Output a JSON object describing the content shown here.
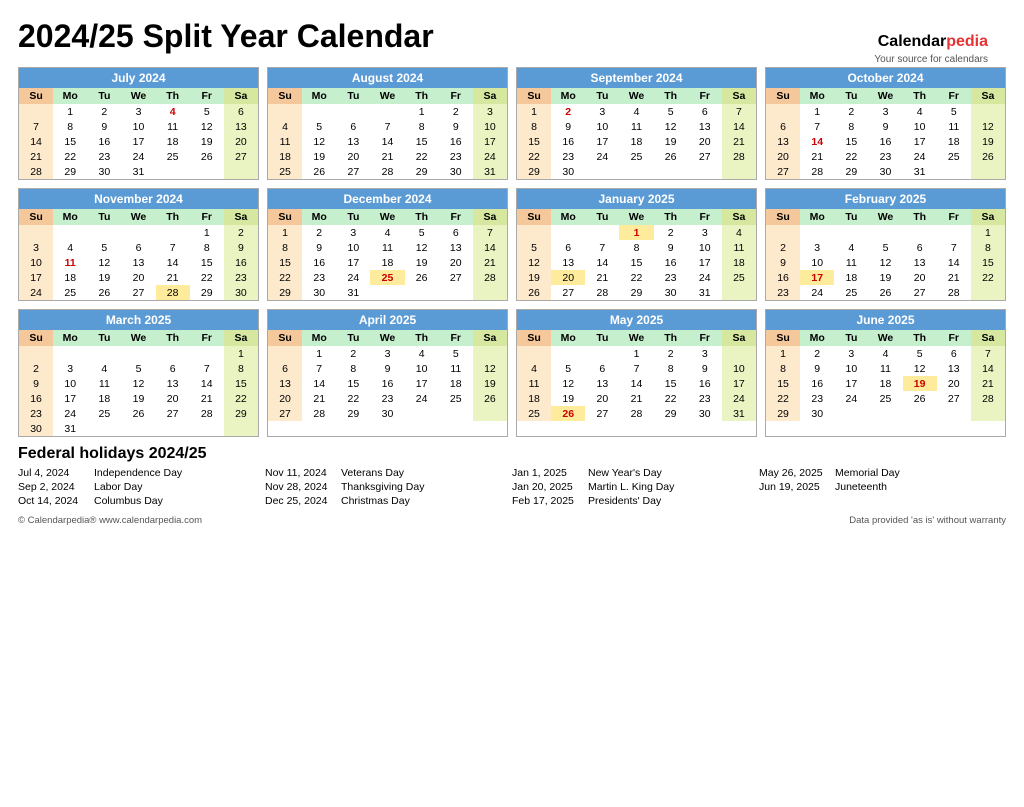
{
  "title": "2024/25 Split Year Calendar",
  "logo": {
    "brand": "Calendar",
    "brand_colored": "pedia",
    "sub": "Your source for calendars"
  },
  "months": [
    {
      "name": "July 2024",
      "start_day": 1,
      "days": 31,
      "weeks": [
        [
          "",
          "1",
          "2",
          "3",
          "4",
          "5",
          "6"
        ],
        [
          "7",
          "8",
          "9",
          "10",
          "11",
          "12",
          "13"
        ],
        [
          "14",
          "15",
          "16",
          "17",
          "18",
          "19",
          "20"
        ],
        [
          "21",
          "22",
          "23",
          "24",
          "25",
          "26",
          "27"
        ],
        [
          "28",
          "29",
          "30",
          "31",
          "",
          "",
          ""
        ]
      ],
      "red_days": [
        "4"
      ],
      "holiday_days": []
    },
    {
      "name": "August 2024",
      "weeks": [
        [
          "",
          "",
          "",
          "",
          "1",
          "2",
          "3"
        ],
        [
          "4",
          "5",
          "6",
          "7",
          "8",
          "9",
          "10"
        ],
        [
          "11",
          "12",
          "13",
          "14",
          "15",
          "16",
          "17"
        ],
        [
          "18",
          "19",
          "20",
          "21",
          "22",
          "23",
          "24"
        ],
        [
          "25",
          "26",
          "27",
          "28",
          "29",
          "30",
          "31"
        ]
      ],
      "red_days": [],
      "holiday_days": []
    },
    {
      "name": "September 2024",
      "weeks": [
        [
          "1",
          "2",
          "3",
          "4",
          "5",
          "6",
          "7"
        ],
        [
          "8",
          "9",
          "10",
          "11",
          "12",
          "13",
          "14"
        ],
        [
          "15",
          "16",
          "17",
          "18",
          "19",
          "20",
          "21"
        ],
        [
          "22",
          "23",
          "24",
          "25",
          "26",
          "27",
          "28"
        ],
        [
          "29",
          "30",
          "",
          "",
          "",
          "",
          ""
        ]
      ],
      "red_days": [
        "2"
      ],
      "holiday_days": []
    },
    {
      "name": "October 2024",
      "weeks": [
        [
          "",
          "1",
          "2",
          "3",
          "4",
          "5",
          ""
        ],
        [
          "6",
          "7",
          "8",
          "9",
          "10",
          "11",
          "12"
        ],
        [
          "13",
          "14",
          "15",
          "16",
          "17",
          "18",
          "19"
        ],
        [
          "20",
          "21",
          "22",
          "23",
          "24",
          "25",
          "26"
        ],
        [
          "27",
          "28",
          "29",
          "30",
          "31",
          "",
          ""
        ]
      ],
      "red_days": [
        "14"
      ],
      "holiday_days": []
    },
    {
      "name": "November 2024",
      "weeks": [
        [
          "",
          "",
          "",
          "",
          "",
          "1",
          "2"
        ],
        [
          "3",
          "4",
          "5",
          "6",
          "7",
          "8",
          "9"
        ],
        [
          "10",
          "11",
          "12",
          "13",
          "14",
          "15",
          "16"
        ],
        [
          "17",
          "18",
          "19",
          "20",
          "21",
          "22",
          "23"
        ],
        [
          "24",
          "25",
          "26",
          "27",
          "28",
          "29",
          "30"
        ]
      ],
      "red_days": [
        "11"
      ],
      "holiday_days": [
        "28"
      ]
    },
    {
      "name": "December 2024",
      "weeks": [
        [
          "1",
          "2",
          "3",
          "4",
          "5",
          "6",
          "7"
        ],
        [
          "8",
          "9",
          "10",
          "11",
          "12",
          "13",
          "14"
        ],
        [
          "15",
          "16",
          "17",
          "18",
          "19",
          "20",
          "21"
        ],
        [
          "22",
          "23",
          "24",
          "25",
          "26",
          "27",
          "28"
        ],
        [
          "29",
          "30",
          "31",
          "",
          "",
          "",
          ""
        ]
      ],
      "red_days": [
        "25"
      ],
      "holiday_days": [
        "25"
      ]
    },
    {
      "name": "January 2025",
      "weeks": [
        [
          "",
          "",
          "",
          "1",
          "2",
          "3",
          "4"
        ],
        [
          "5",
          "6",
          "7",
          "8",
          "9",
          "10",
          "11"
        ],
        [
          "12",
          "13",
          "14",
          "15",
          "16",
          "17",
          "18"
        ],
        [
          "19",
          "20",
          "21",
          "22",
          "23",
          "24",
          "25"
        ],
        [
          "26",
          "27",
          "28",
          "29",
          "30",
          "31",
          ""
        ]
      ],
      "red_days": [
        "1"
      ],
      "holiday_days": [
        "1",
        "20"
      ]
    },
    {
      "name": "February 2025",
      "weeks": [
        [
          "",
          "",
          "",
          "",
          "",
          "",
          "1"
        ],
        [
          "2",
          "3",
          "4",
          "5",
          "6",
          "7",
          "8"
        ],
        [
          "9",
          "10",
          "11",
          "12",
          "13",
          "14",
          "15"
        ],
        [
          "16",
          "17",
          "18",
          "19",
          "20",
          "21",
          "22"
        ],
        [
          "23",
          "24",
          "25",
          "26",
          "27",
          "28",
          ""
        ]
      ],
      "red_days": [
        "17"
      ],
      "holiday_days": [
        "17"
      ]
    },
    {
      "name": "March 2025",
      "weeks": [
        [
          "",
          "",
          "",
          "",
          "",
          "",
          "1"
        ],
        [
          "2",
          "3",
          "4",
          "5",
          "6",
          "7",
          "8"
        ],
        [
          "9",
          "10",
          "11",
          "12",
          "13",
          "14",
          "15"
        ],
        [
          "16",
          "17",
          "18",
          "19",
          "20",
          "21",
          "22"
        ],
        [
          "23",
          "24",
          "25",
          "26",
          "27",
          "28",
          "29"
        ],
        [
          "30",
          "31",
          "",
          "",
          "",
          "",
          ""
        ]
      ],
      "red_days": [],
      "holiday_days": []
    },
    {
      "name": "April 2025",
      "weeks": [
        [
          "",
          "1",
          "2",
          "3",
          "4",
          "5",
          ""
        ],
        [
          "6",
          "7",
          "8",
          "9",
          "10",
          "11",
          "12"
        ],
        [
          "13",
          "14",
          "15",
          "16",
          "17",
          "18",
          "19"
        ],
        [
          "20",
          "21",
          "22",
          "23",
          "24",
          "25",
          "26"
        ],
        [
          "27",
          "28",
          "29",
          "30",
          "",
          "",
          ""
        ]
      ],
      "red_days": [],
      "holiday_days": []
    },
    {
      "name": "May 2025",
      "weeks": [
        [
          "",
          "",
          "",
          "1",
          "2",
          "3",
          ""
        ],
        [
          "4",
          "5",
          "6",
          "7",
          "8",
          "9",
          "10"
        ],
        [
          "11",
          "12",
          "13",
          "14",
          "15",
          "16",
          "17"
        ],
        [
          "18",
          "19",
          "20",
          "21",
          "22",
          "23",
          "24"
        ],
        [
          "25",
          "26",
          "27",
          "28",
          "29",
          "30",
          "31"
        ]
      ],
      "red_days": [
        "26"
      ],
      "holiday_days": [
        "26"
      ]
    },
    {
      "name": "June 2025",
      "weeks": [
        [
          "1",
          "2",
          "3",
          "4",
          "5",
          "6",
          "7"
        ],
        [
          "8",
          "9",
          "10",
          "11",
          "12",
          "13",
          "14"
        ],
        [
          "15",
          "16",
          "17",
          "18",
          "19",
          "20",
          "21"
        ],
        [
          "22",
          "23",
          "24",
          "25",
          "26",
          "27",
          "28"
        ],
        [
          "29",
          "30",
          "",
          "",
          "",
          "",
          ""
        ]
      ],
      "red_days": [
        "19"
      ],
      "holiday_days": [
        "19"
      ]
    }
  ],
  "day_headers": [
    "Su",
    "Mo",
    "Tu",
    "We",
    "Th",
    "Fr",
    "Sa"
  ],
  "holidays": [
    {
      "date": "Jul 4, 2024",
      "name": "Independence Day"
    },
    {
      "date": "Sep 2, 2024",
      "name": "Labor Day"
    },
    {
      "date": "Oct 14, 2024",
      "name": "Columbus Day"
    },
    {
      "date": "Nov 11, 2024",
      "name": "Veterans Day"
    },
    {
      "date": "Nov 28, 2024",
      "name": "Thanksgiving Day"
    },
    {
      "date": "Dec 25, 2024",
      "name": "Christmas Day"
    },
    {
      "date": "Jan 1, 2025",
      "name": "New Year's Day"
    },
    {
      "date": "Jan 20, 2025",
      "name": "Martin L. King Day"
    },
    {
      "date": "Feb 17, 2025",
      "name": "Presidents' Day"
    },
    {
      "date": "May 26, 2025",
      "name": "Memorial Day"
    },
    {
      "date": "Jun 19, 2025",
      "name": "Juneteenth"
    }
  ],
  "footer_left": "© Calendarpedia®   www.calendarpedia.com",
  "footer_right": "Data provided 'as is' without warranty"
}
